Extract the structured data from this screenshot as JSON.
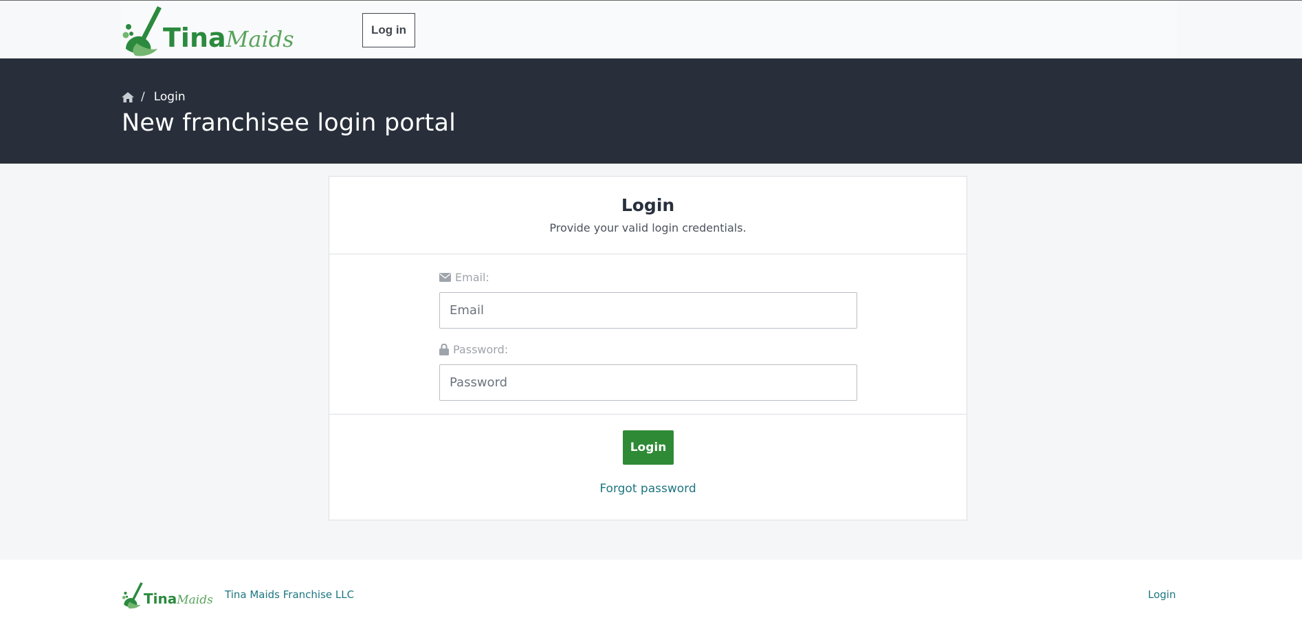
{
  "brand": {
    "name_part1": "Tina",
    "name_part2": "Maids",
    "primary_color": "#2b8a3e",
    "secondary_color": "#5aa35d"
  },
  "nav": {
    "login_button": "Log in"
  },
  "hero": {
    "home_icon": "home-icon",
    "breadcrumb_separator": "/",
    "breadcrumb_current": "Login",
    "title": "New franchisee login portal",
    "background_color": "#282f3b"
  },
  "login_card": {
    "title": "Login",
    "subtitle": "Provide your valid login credentials.",
    "email": {
      "icon": "envelope-icon",
      "label": "Email:",
      "placeholder": "Email",
      "value": ""
    },
    "password": {
      "icon": "lock-icon",
      "label": "Password:",
      "placeholder": "Password",
      "value": ""
    },
    "submit_label": "Login",
    "submit_color": "#2e8a35",
    "forgot_password_label": "Forgot password"
  },
  "footer": {
    "company": "Tina Maids Franchise LLC",
    "login_link": "Login",
    "link_color": "#1c7580"
  }
}
